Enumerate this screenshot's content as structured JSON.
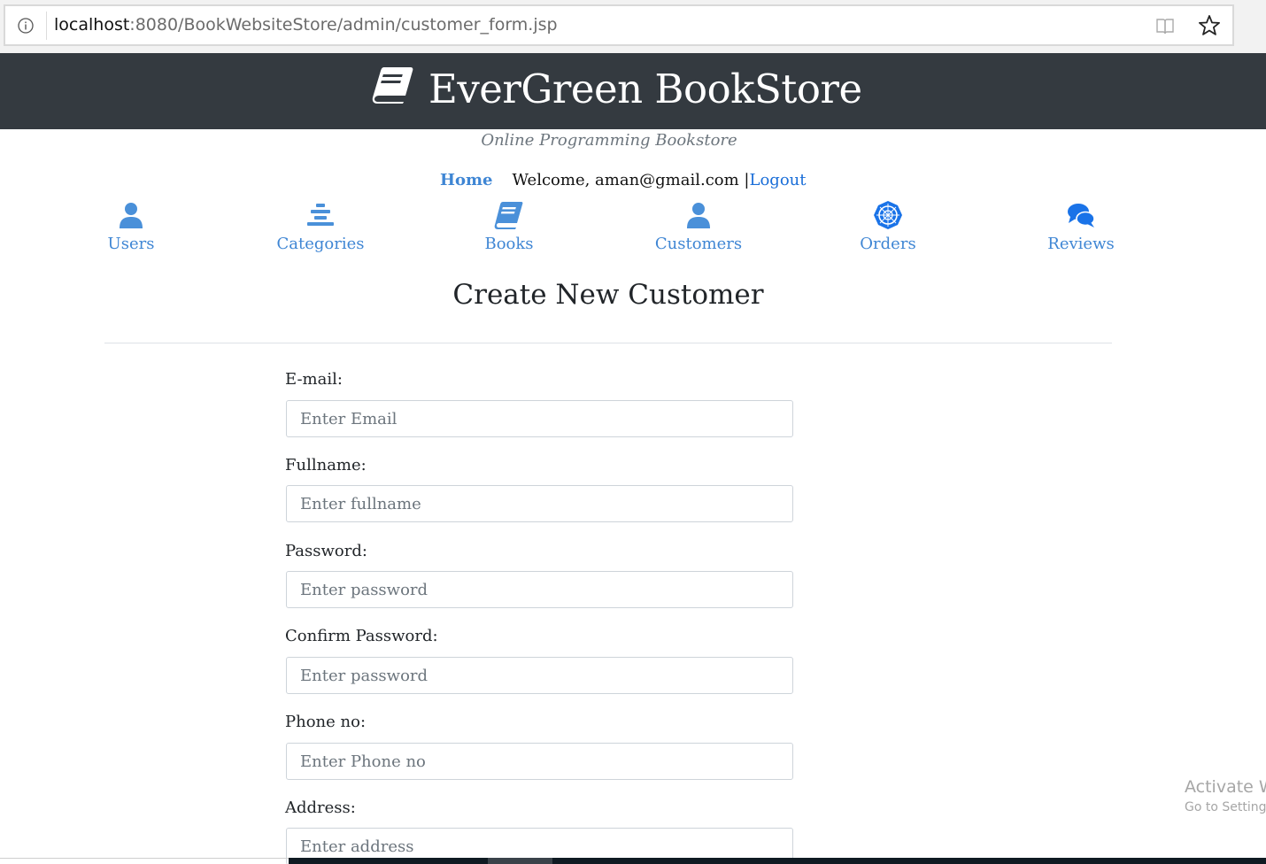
{
  "browser": {
    "url_host": "localhost",
    "url_rest": ":8080/BookWebsiteStore/admin/customer_form.jsp"
  },
  "header": {
    "title": "EverGreen BookStore",
    "tagline": "Online Programming Bookstore",
    "home_link": "Home",
    "welcome_text": "Welcome, aman@gmail.com |",
    "logout_link": "Logout"
  },
  "menu": {
    "items": [
      {
        "label": "Users",
        "icon": "user-icon"
      },
      {
        "label": "Categories",
        "icon": "categories-icon"
      },
      {
        "label": "Books",
        "icon": "book-icon"
      },
      {
        "label": "Customers",
        "icon": "customer-icon"
      },
      {
        "label": "Orders",
        "icon": "orders-icon"
      },
      {
        "label": "Reviews",
        "icon": "reviews-icon"
      }
    ]
  },
  "form": {
    "title": "Create New Customer",
    "fields": [
      {
        "label": "E-mail:",
        "placeholder": "Enter Email"
      },
      {
        "label": "Fullname:",
        "placeholder": "Enter fullname"
      },
      {
        "label": "Password:",
        "placeholder": "Enter password"
      },
      {
        "label": "Confirm Password:",
        "placeholder": "Enter password"
      },
      {
        "label": "Phone no:",
        "placeholder": "Enter Phone no"
      },
      {
        "label": "Address:",
        "placeholder": "Enter address"
      }
    ]
  },
  "watermark": {
    "line1": "Activate W",
    "line2": "Go to Settings"
  },
  "colors": {
    "header_bg": "#343a40",
    "link": "#3f86d4",
    "orders_icon": "#1a73e8"
  }
}
